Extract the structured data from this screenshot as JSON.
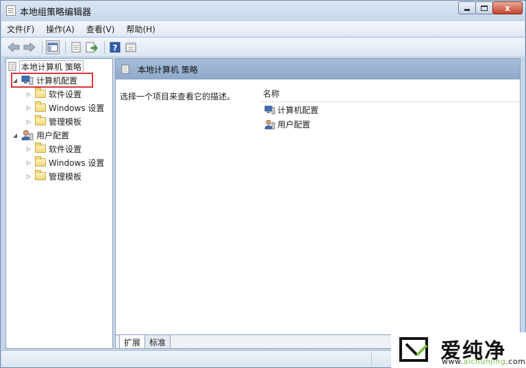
{
  "window": {
    "title": "本地组策略编辑器",
    "buttons": {
      "close": "x"
    }
  },
  "menu": {
    "items": [
      "文件(F)",
      "操作(A)",
      "查看(V)",
      "帮助(H)"
    ]
  },
  "toolbar": {
    "icons": [
      "back-arrow-icon",
      "forward-arrow-icon",
      "show-hide-console-tree-icon",
      "properties-icon",
      "export-list-icon",
      "help-icon",
      "action-pane-icon"
    ]
  },
  "tree": {
    "root": "本地计算机 策略",
    "computer_config": {
      "label": "计算机配置",
      "children": [
        "软件设置",
        "Windows 设置",
        "管理模板"
      ]
    },
    "user_config": {
      "label": "用户配置",
      "children": [
        "软件设置",
        "Windows 设置",
        "管理模板"
      ]
    }
  },
  "right": {
    "header_title": "本地计算机 策略",
    "description": "选择一个项目来查看它的描述。",
    "column_name": "名称",
    "items": [
      "计算机配置",
      "用户配置"
    ],
    "tabs": [
      "扩展",
      "标准"
    ]
  },
  "watermark": {
    "brand": "爱纯净",
    "url_prefix": "www.",
    "url_accent": "aichunjing",
    "url_suffix": ".com"
  },
  "colors": {
    "highlight_box": "#d9343a",
    "header_band": "#8fa9cb",
    "watermark_accent": "#7cc14a"
  }
}
